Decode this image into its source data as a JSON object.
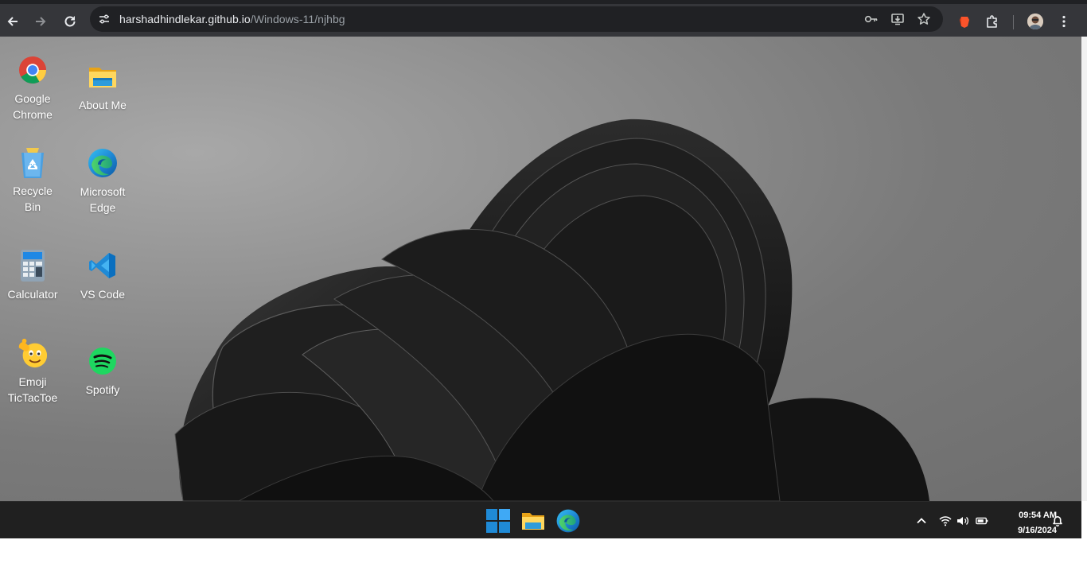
{
  "browser": {
    "url_host": "harshadhindlekar.github.io",
    "url_path": "/Windows-11/njhbg",
    "icons": [
      "back-arrow-icon",
      "forward-arrow-icon",
      "reload-icon",
      "site-info-icon",
      "password-key-icon",
      "install-app-icon",
      "bookmark-star-icon",
      "extension-brave-icon",
      "extensions-puzzle-icon",
      "profile-avatar",
      "more-menu-icon"
    ]
  },
  "desktop": {
    "icons": [
      {
        "label": "Google Chrome",
        "icon": "chrome-icon"
      },
      {
        "label": "About Me",
        "icon": "folder-icon"
      },
      {
        "label": "Recycle Bin",
        "icon": "recycle-bin-icon"
      },
      {
        "label": "Microsoft Edge",
        "icon": "edge-icon"
      },
      {
        "label": "Calculator",
        "icon": "calculator-icon"
      },
      {
        "label": "VS Code",
        "icon": "vscode-icon"
      },
      {
        "label": "Emoji TicTacToe",
        "icon": "emoji-icon"
      },
      {
        "label": "Spotify",
        "icon": "spotify-icon"
      }
    ]
  },
  "taskbar": {
    "apps": [
      "windows-start-icon",
      "file-explorer-icon",
      "edge-icon"
    ],
    "tray": [
      "chevron-up-icon",
      "wifi-icon",
      "volume-icon",
      "battery-icon",
      "notification-bell-icon"
    ],
    "time": "09:54 AM",
    "date": "9/16/2024"
  },
  "colors": {
    "chrome_bar": "#35363a",
    "omnibox": "#202124",
    "taskbar": "#202020",
    "windows_blue": "#1f8ad6"
  }
}
